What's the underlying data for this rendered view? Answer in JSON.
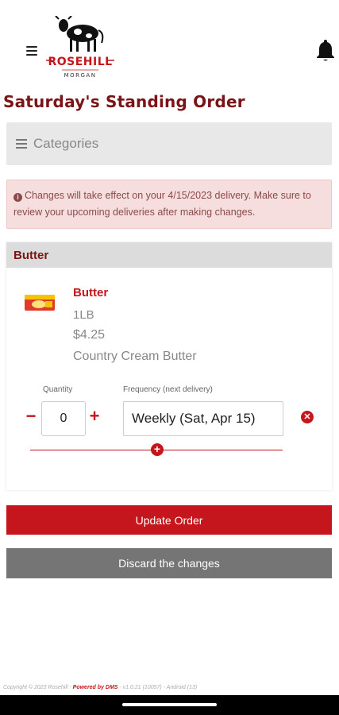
{
  "header": {
    "logo_text": "ROSEHILL",
    "logo_subtext": "MORGAN"
  },
  "page_title": "Saturday's Standing Order",
  "categories": {
    "label": "Categories"
  },
  "alert": {
    "message": "Changes will take effect on your 4/15/2023 delivery. Make sure to review your upcoming deliveries after making changes."
  },
  "card": {
    "header": "Butter",
    "product": {
      "name": "Butter",
      "size": "1LB",
      "price": "$4.25",
      "description": "Country Cream Butter"
    },
    "quantity_label": "Quantity",
    "quantity_value": "0",
    "frequency_label": "Frequency (next delivery)",
    "frequency_value": "Weekly (Sat, Apr 15)"
  },
  "buttons": {
    "update": "Update Order",
    "discard": "Discard the changes"
  },
  "footer": {
    "copyright": "Copyright © 2023 Rosehill - ",
    "powered": "Powered by DMS",
    "version": " - v1.0.21 (10057) - Android (13)"
  },
  "colors": {
    "brand": "#c4161c",
    "title": "#7b1416",
    "discard": "#757575"
  }
}
